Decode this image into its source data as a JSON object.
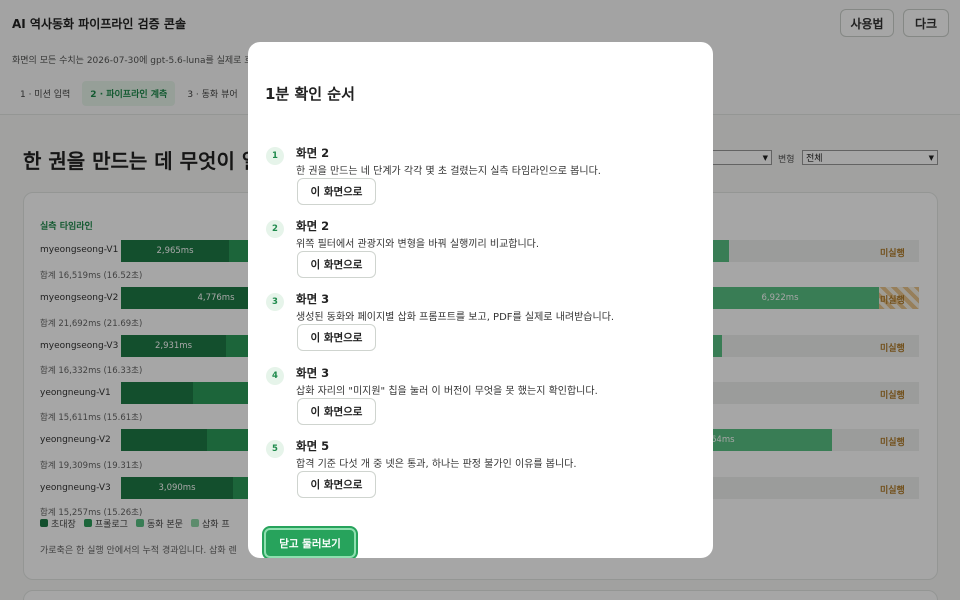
{
  "app": {
    "title": "AI 역사동화 파이프라인 검증 콘솔",
    "usage_button": "사용법",
    "dark_button": "다크",
    "subtitle": "화면의 모든 수치는 2026-07-30에 gpt-5.6-luna를 실제로 호"
  },
  "tabs": [
    {
      "label": "1 · 미션 입력",
      "active": false
    },
    {
      "label": "2 · 파이프라인 계측",
      "active": true
    },
    {
      "label": "3 · 동화 뷰어",
      "active": false
    }
  ],
  "page": {
    "heading": "한 권을 만드는 데 무엇이 얼",
    "filter_a_value": "",
    "variant_label": "변형",
    "variant_value": "전체"
  },
  "timeline": {
    "title": "실측 타임라인",
    "status_label": "미실행",
    "rows": [
      {
        "name": "myeongseong-V1",
        "total": "합계 16,519ms (16.52초)",
        "seg1": "2,965ms",
        "seg2": "",
        "status": "미실행"
      },
      {
        "name": "myeongseong-V2",
        "total": "합계 21,692ms (21.69초)",
        "seg1": "4,776ms",
        "seg2": "6,922ms",
        "status": "미실행"
      },
      {
        "name": "myeongseong-V3",
        "total": "합계 16,332ms (16.33초)",
        "seg1": "2,931ms",
        "seg2": "",
        "status": "미실행"
      },
      {
        "name": "yeongneung-V1",
        "total": "합계 15,611ms (15.61초)",
        "seg1": "",
        "seg2": "",
        "status": "미실행"
      },
      {
        "name": "yeongneung-V2",
        "total": "합계 19,309ms (19.31초)",
        "seg1": "2",
        "seg2": "64ms",
        "status": "미실행"
      },
      {
        "name": "yeongneung-V3",
        "total": "합계 15,257ms (15.26초)",
        "seg1": "3,090ms",
        "seg2": "",
        "status": "미실행"
      }
    ],
    "legend": [
      "초대장",
      "프롤로그",
      "동화 본문",
      "삽화 프"
    ],
    "footnote": "가로축은 한 실행 안에서의 누적 경과입니다. 삽화 렌"
  },
  "modal": {
    "title": "1분 확인 순서",
    "close_label": "닫고 둘러보기",
    "steps": [
      {
        "num": "1",
        "screen": "화면 2",
        "desc": "한 권을 만드는 네 단계가 각각 몇 초 걸렸는지 실측 타임라인으로 봅니다.",
        "button": "이 화면으로"
      },
      {
        "num": "2",
        "screen": "화면 2",
        "desc": "위쪽 필터에서 관광지와 변형을 바꿔 실행끼리 비교합니다.",
        "button": "이 화면으로"
      },
      {
        "num": "3",
        "screen": "화면 3",
        "desc": "생성된 동화와 페이지별 삽화 프롬프트를 보고, PDF를 실제로 내려받습니다.",
        "button": "이 화면으로"
      },
      {
        "num": "4",
        "screen": "화면 3",
        "desc": "삽화 자리의 \"미지원\" 칩을 눌러 이 버전이 무엇을 못 했는지 확인합니다.",
        "button": "이 화면으로"
      },
      {
        "num": "5",
        "screen": "화면 5",
        "desc": "합격 기준 다섯 개 중 넷은 통과, 하나는 판정 불가인 이유를 봅니다.",
        "button": "이 화면으로"
      }
    ]
  }
}
